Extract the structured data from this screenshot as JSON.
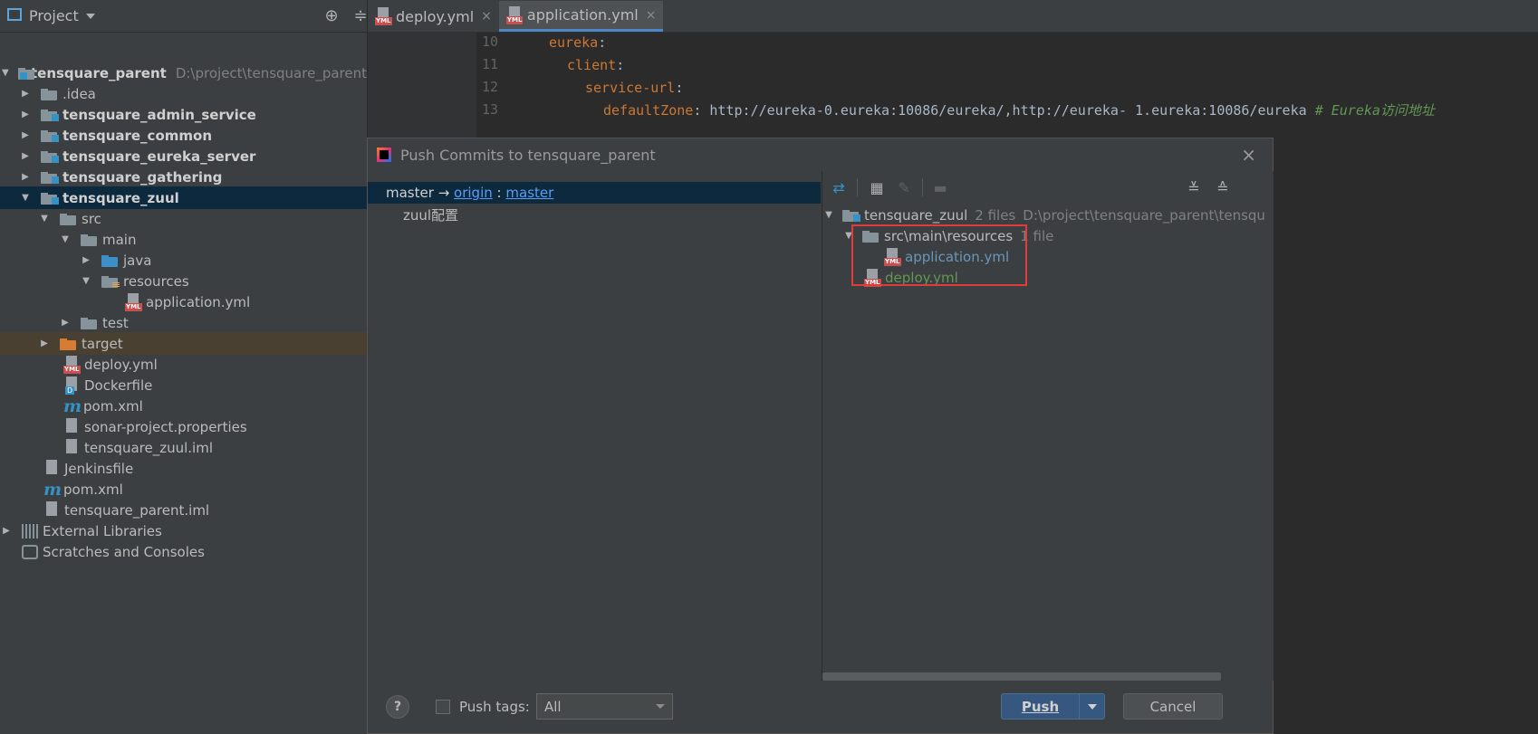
{
  "project_panel": {
    "title": "Project",
    "tree": [
      {
        "label": "tensquare_parent",
        "path": "D:\\project\\tensquare_parent"
      },
      {
        "label": ".idea"
      },
      {
        "label": "tensquare_admin_service"
      },
      {
        "label": "tensquare_common"
      },
      {
        "label": "tensquare_eureka_server"
      },
      {
        "label": "tensquare_gathering"
      },
      {
        "label": "tensquare_zuul"
      },
      {
        "label": "src"
      },
      {
        "label": "main"
      },
      {
        "label": "java"
      },
      {
        "label": "resources"
      },
      {
        "label": "application.yml"
      },
      {
        "label": "test"
      },
      {
        "label": "target"
      },
      {
        "label": "deploy.yml"
      },
      {
        "label": "Dockerfile"
      },
      {
        "label": "pom.xml"
      },
      {
        "label": "sonar-project.properties"
      },
      {
        "label": "tensquare_zuul.iml"
      },
      {
        "label": "Jenkinsfile"
      },
      {
        "label": "pom.xml"
      },
      {
        "label": "tensquare_parent.iml"
      },
      {
        "label": "External Libraries"
      },
      {
        "label": "Scratches and Consoles"
      }
    ]
  },
  "editor": {
    "tabs": [
      {
        "label": "deploy.yml",
        "close": "×"
      },
      {
        "label": "application.yml",
        "close": "×"
      }
    ],
    "lines": [
      {
        "num": "10",
        "key": "eureka",
        "rest": ":"
      },
      {
        "num": "11",
        "key": "client",
        "rest": ":"
      },
      {
        "num": "12",
        "key": "service-url",
        "rest": ":"
      },
      {
        "num": "13",
        "key": "defaultZone",
        "rest": ": http://eureka-0.eureka:10086/eureka/,http://eureka- 1.eureka:10086/eureka",
        "comment": "# Eureka访问地址"
      }
    ]
  },
  "dialog": {
    "title": "Push Commits to tensquare_parent",
    "close": "×",
    "branch": {
      "local": "master",
      "arrow": "→",
      "remote": "origin",
      "sep": ":",
      "target": "master"
    },
    "commit": "zuul配置",
    "changes": {
      "root": {
        "label": "tensquare_zuul",
        "count": "2 files",
        "path": "D:\\project\\tensquare_parent\\tensqu"
      },
      "dir": {
        "label": "src\\main\\resources",
        "count": "1 file"
      },
      "files": [
        {
          "label": "application.yml",
          "status": "modified"
        },
        {
          "label": "deploy.yml",
          "status": "added"
        }
      ]
    },
    "help": "?",
    "push_tags_label": "Push tags:",
    "push_tags_checked": false,
    "push_tags_value": "All",
    "push_button": "Push",
    "cancel_button": "Cancel"
  },
  "colors": {
    "accent_modified": "#6897bb",
    "accent_added": "#629755",
    "highlight_box": "#e03c3c"
  }
}
